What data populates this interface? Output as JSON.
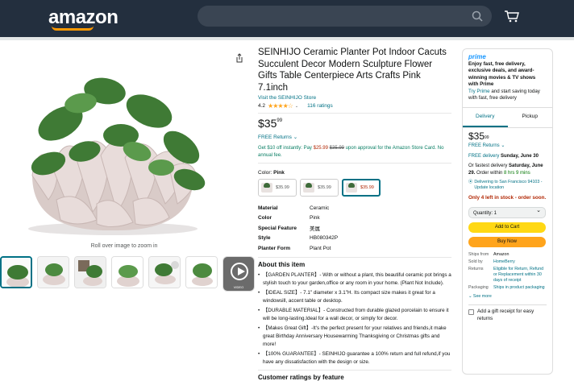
{
  "header": {
    "logo_text": "amazon",
    "search_icon": "search-icon",
    "cart_icon": "cart-icon"
  },
  "gallery": {
    "zoom_hint": "Roll over image to zoom in",
    "video_label": "VIDEO"
  },
  "product": {
    "title": "SEINHIJO Ceramic Planter Pot Indoor Cacuts Succulent Decor Modern Sculpture Flower Gifts Table Centerpiece Arts Crafts Pink 7.1inch",
    "store_link": "Visit the SEINHIJO Store",
    "rating_value": "4.2",
    "stars": "★★★★☆",
    "rating_count": "116 ratings",
    "price_whole": "$35",
    "price_fraction": "99",
    "free_returns": "FREE Returns ⌄",
    "promo_pre": "Get $10 off instantly: Pay",
    "promo_new_price": "$25.99",
    "promo_old_price": "$35.99",
    "promo_post": "upon approval for the Amazon Store Card. No annual fee.",
    "color_label": "Color:",
    "color_value": "Pink",
    "swatches": [
      {
        "price": "$35.99"
      },
      {
        "price": "$35.99"
      },
      {
        "price": "$35.99"
      }
    ],
    "specs": [
      {
        "k": "Material",
        "v": "Ceramic"
      },
      {
        "k": "Color",
        "v": "Pink"
      },
      {
        "k": "Special Feature",
        "v": "美属"
      },
      {
        "k": "Style",
        "v": "HB080342P"
      },
      {
        "k": "Planter Form",
        "v": "Plant Pot"
      }
    ],
    "about_heading": "About this item",
    "bullets": [
      "【GARDEN PLANTER】- With or without a plant, this beautiful ceramic pot brings a stylish touch to your garden,office or any room in your home. (Plant Not Include).",
      "【IDEAL SIZE】- 7.1\" diameter x 3.1\"H. Its compact size makes it great for a windowsill, accent table or desktop.",
      "【DURABLE MATERIAL】- Constructed from durable glazed porcelain to ensure it will be long-lasting.Ideal for a wall decor, or simply for decor.",
      "【Makes Great Gift】-It's the perfect present for your relatives and friends,it make great Birthday Anniversary Housewarming Thanksgiving or Christmas gifts and more!",
      "【100% GUARANTEE】- SEINHIJO guarantee a 100% return and full refund,if you have any dissatisfaction with the design or size."
    ],
    "ratings_heading": "Customer ratings by feature"
  },
  "buybox": {
    "prime_logo": "prime",
    "prime_text_bold": "Enjoy fast, free delivery, exclusive deals, and award-winning movies & TV shows with Prime",
    "prime_link": "Try Prime",
    "prime_text_tail": "and start saving today with fast, free delivery",
    "tab_delivery": "Delivery",
    "tab_pickup": "Pickup",
    "price_whole": "$35",
    "price_fraction": "99",
    "free_returns": "FREE Returns ⌄",
    "delivery_pre": "FREE delivery",
    "delivery_date": "Sunday, June 30",
    "fastest_pre": "Or fastest delivery",
    "fastest_date": "Saturday, June 29.",
    "fastest_order": "Order within",
    "fastest_time": "8 hrs 9 mins",
    "location": "Delivering to San Francisco 94103 - Update location",
    "stock": "Only 4 left in stock - order soon.",
    "quantity": "Quantity: 1",
    "add_to_cart": "Add to Cart",
    "buy_now": "Buy Now",
    "ships_from_k": "Ships from",
    "ships_from_v": "Amazon",
    "sold_by_k": "Sold by",
    "sold_by_v": "HomeBerry",
    "returns_k": "Returns",
    "returns_v": "Eligible for Return, Refund or Replacement within 30 days of receipt",
    "packaging_k": "Packaging",
    "packaging_v": "Ships in product packaging",
    "see_more": "⌄ See more",
    "gift": "Add a gift receipt for easy returns"
  }
}
